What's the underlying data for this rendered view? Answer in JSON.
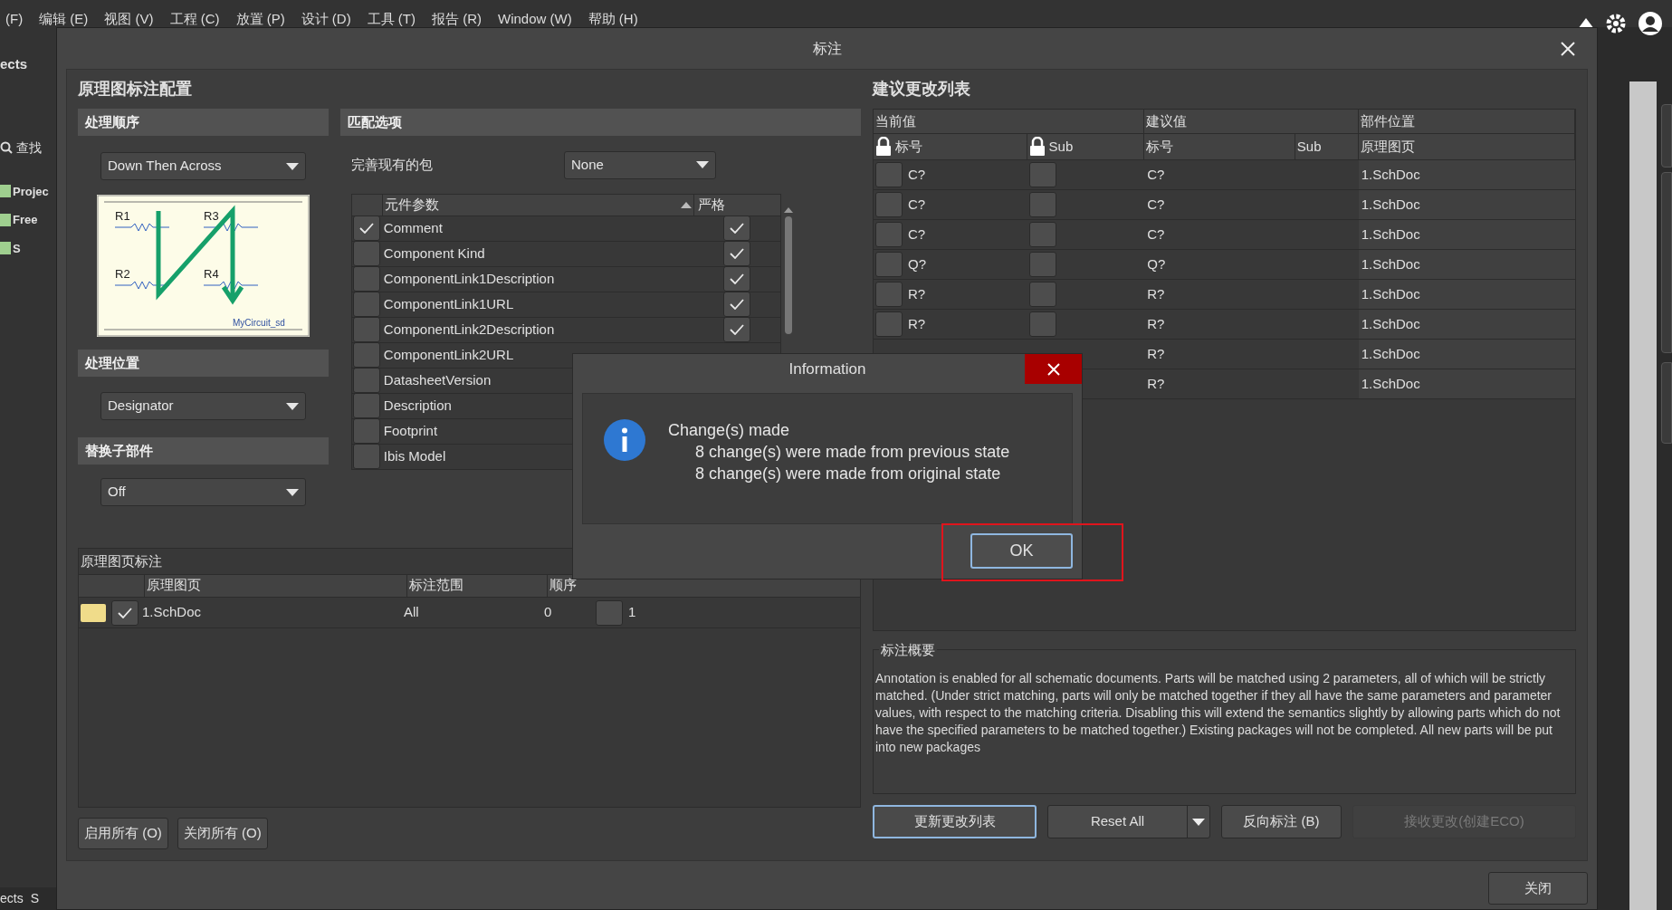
{
  "menu": [
    "(F)",
    "编辑 (E)",
    "视图 (V)",
    "工程 (C)",
    "放置 (P)",
    "设计 (D)",
    "工具 (T)",
    "报告 (R)",
    "Window (W)",
    "帮助 (H)"
  ],
  "sidebar": {
    "title": "ects",
    "search": "查找",
    "items": [
      "Projec",
      "Free",
      "S"
    ],
    "bottom_tabs": [
      "ects",
      "S"
    ]
  },
  "dialog": {
    "title": "标注",
    "config": {
      "title": "原理图标注配置",
      "order": {
        "header": "处理顺序",
        "value": "Down Then Across",
        "diagram_labels": [
          "R1",
          "R3",
          "R2",
          "R4"
        ],
        "diagram_caption": "MyCircuit_sd"
      },
      "location": {
        "header": "处理位置",
        "value": "Designator"
      },
      "replace": {
        "header": "替换子部件",
        "value": "Off"
      },
      "matching": {
        "header": "匹配选项",
        "complete_label": "完善现有的包",
        "complete_value": "None",
        "columns": [
          "元件参数",
          "严格"
        ],
        "params": [
          {
            "name": "Comment",
            "checked": true,
            "strict": true
          },
          {
            "name": "Component Kind",
            "checked": false,
            "strict": true
          },
          {
            "name": "ComponentLink1Description",
            "checked": false,
            "strict": true
          },
          {
            "name": "ComponentLink1URL",
            "checked": false,
            "strict": true
          },
          {
            "name": "ComponentLink2Description",
            "checked": false,
            "strict": true
          },
          {
            "name": "ComponentLink2URL",
            "checked": false
          },
          {
            "name": "DatasheetVersion",
            "checked": false
          },
          {
            "name": "Description",
            "checked": false
          },
          {
            "name": "Footprint",
            "checked": false
          },
          {
            "name": "Ibis Model",
            "checked": false
          }
        ]
      },
      "sheets": {
        "header": "原理图页标注",
        "columns": [
          "原理图页",
          "标注范围",
          "顺序"
        ],
        "rows": [
          {
            "sheet": "1.SchDoc",
            "checked": true,
            "scope": "All",
            "order": "0",
            "column_5_checked": false,
            "column_5": "1"
          }
        ]
      },
      "buttons": [
        "启用所有 (O)",
        "关闭所有 (O)"
      ]
    },
    "changes": {
      "title": "建议更改列表",
      "groups": [
        "当前值",
        "建议值",
        "部件位置"
      ],
      "columns": [
        "标号",
        "Sub",
        "标号",
        "Sub",
        "原理图页"
      ],
      "rows": [
        {
          "current_locked": false,
          "current": "C?",
          "sub_locked": false,
          "proposed": "C?",
          "sheet": "1.SchDoc"
        },
        {
          "current_locked": false,
          "current": "C?",
          "sub_locked": false,
          "proposed": "C?",
          "sheet": "1.SchDoc"
        },
        {
          "current_locked": false,
          "current": "C?",
          "sub_locked": false,
          "proposed": "C?",
          "sheet": "1.SchDoc"
        },
        {
          "current_locked": false,
          "current": "Q?",
          "sub_locked": false,
          "proposed": "Q?",
          "sheet": "1.SchDoc"
        },
        {
          "current_locked": false,
          "current": "R?",
          "sub_locked": false,
          "proposed": "R?",
          "sheet": "1.SchDoc"
        },
        {
          "current_locked": false,
          "current": "R?",
          "sub_locked": false,
          "proposed": "R?",
          "sheet": "1.SchDoc"
        },
        {
          "proposed": "R?",
          "sheet": "1.SchDoc"
        },
        {
          "proposed": "R?",
          "sheet": "1.SchDoc"
        }
      ],
      "summary_title": "标注概要",
      "summary": "Annotation is enabled for all schematic documents. Parts will be matched using 2 parameters, all of which will be strictly matched. (Under strict matching, parts will only be matched together if they all have the same parameters and parameter values, with respect to the matching criteria. Disabling this will extend the semantics slightly by allowing parts which do not have the specified parameters to be matched together.) Existing packages will not be completed. All new parts will be put into new packages",
      "buttons": [
        {
          "label": "更新更改列表",
          "kind": "primary",
          "disabled": false
        },
        {
          "label": "Reset All",
          "kind": "split",
          "disabled": false
        },
        {
          "label": "反向标注 (B)",
          "kind": "plain",
          "disabled": false
        },
        {
          "label": "接收更改(创建ECO)",
          "kind": "plain",
          "disabled": true
        }
      ]
    },
    "close": "关闭"
  },
  "info": {
    "title": "Information",
    "heading": "Change(s) made",
    "lines": [
      "8 change(s) were made from previous state",
      "8 change(s) were made from original state"
    ],
    "button": "OK"
  }
}
